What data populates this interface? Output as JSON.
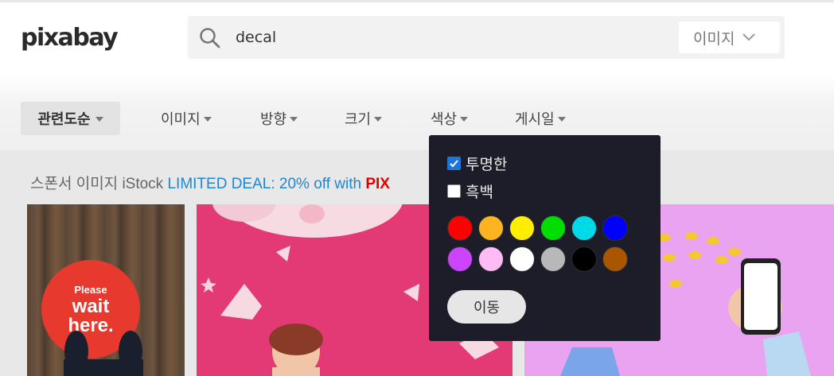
{
  "header": {
    "logo": "pixabay",
    "search": {
      "value": "decal",
      "placeholder": ""
    },
    "type_select": {
      "label": "이미지"
    }
  },
  "filters": {
    "sort_label": "관련도순",
    "items": [
      {
        "label": "이미지"
      },
      {
        "label": "방향"
      },
      {
        "label": "크기"
      },
      {
        "label": "색상"
      },
      {
        "label": "게시일"
      }
    ]
  },
  "sponsor": {
    "prefix": "스폰서 이미지 iStock",
    "deal": "LIMITED DEAL: 20% off with",
    "code": "PIX"
  },
  "color_popup": {
    "transparent_label": "투명한",
    "transparent_checked": true,
    "grayscale_label": "흑백",
    "grayscale_checked": false,
    "swatches": [
      "#ff0000",
      "#ffb320",
      "#ffee00",
      "#00dd00",
      "#00d9e8",
      "#0000ff",
      "#cc44ff",
      "#ffbbf6",
      "#ffffff",
      "#b8b8b8",
      "#000000",
      "#aa5500"
    ],
    "go_label": "이동"
  },
  "thumbnails": {
    "sign_line1": "Please",
    "sign_line2": "wait",
    "sign_line3": "here."
  }
}
